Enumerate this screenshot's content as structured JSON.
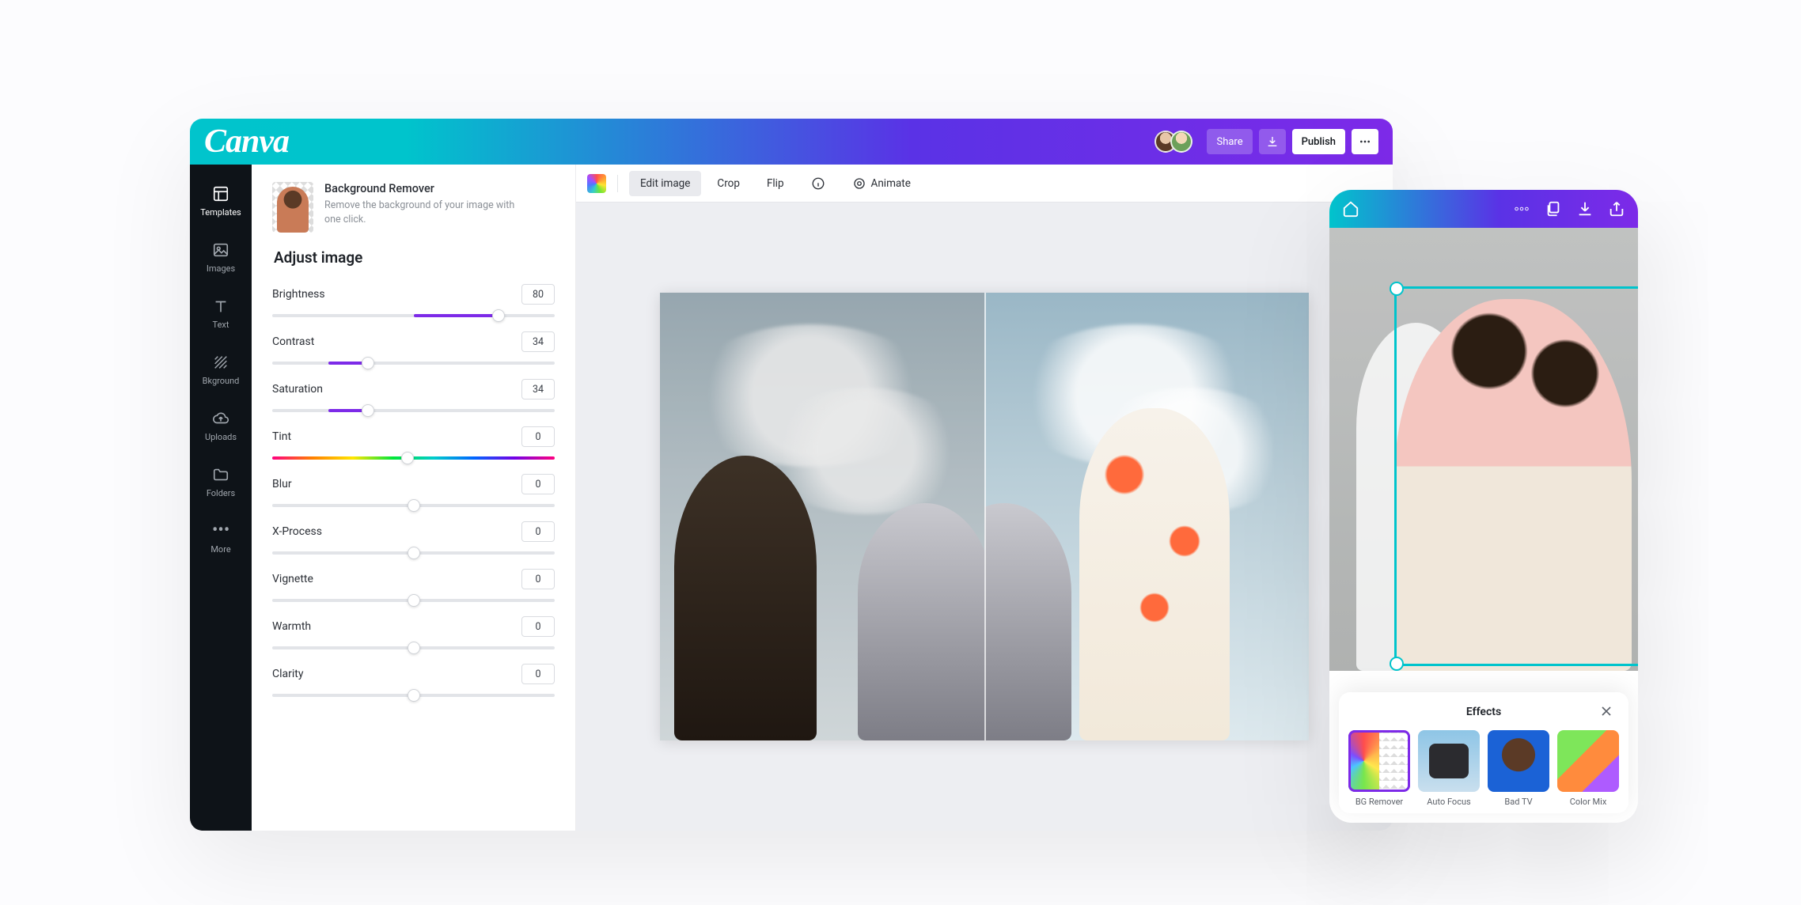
{
  "desktop": {
    "brand": "Canva",
    "header": {
      "share_label": "Share",
      "publish_label": "Publish"
    },
    "leftnav": [
      {
        "name": "templates",
        "label": "Templates",
        "icon": "templates-icon"
      },
      {
        "name": "images",
        "label": "Images",
        "icon": "image-icon"
      },
      {
        "name": "text",
        "label": "Text",
        "icon": "text-icon"
      },
      {
        "name": "bkground",
        "label": "Bkground",
        "icon": "background-icon"
      },
      {
        "name": "uploads",
        "label": "Uploads",
        "icon": "upload-icon"
      },
      {
        "name": "folders",
        "label": "Folders",
        "icon": "folder-icon"
      },
      {
        "name": "more",
        "label": "More",
        "icon": "more-icon"
      }
    ],
    "panel": {
      "bg_remover_title": "Background Remover",
      "bg_remover_sub": "Remove the background of your image with one click.",
      "heading": "Adjust image",
      "sliders": [
        {
          "key": "brightness",
          "label": "Brightness",
          "value": 80,
          "pct": 80,
          "variant": "normal",
          "fill_from": 50
        },
        {
          "key": "contrast",
          "label": "Contrast",
          "value": 34,
          "pct": 34,
          "variant": "normal",
          "fill_from": 20
        },
        {
          "key": "saturation",
          "label": "Saturation",
          "value": 34,
          "pct": 34,
          "variant": "normal",
          "fill_from": 20
        },
        {
          "key": "tint",
          "label": "Tint",
          "value": 0,
          "pct": 48,
          "variant": "tint"
        },
        {
          "key": "blur",
          "label": "Blur",
          "value": 0,
          "pct": 50,
          "variant": "plain"
        },
        {
          "key": "xprocess",
          "label": "X-Process",
          "value": 0,
          "pct": 50,
          "variant": "plain"
        },
        {
          "key": "vignette",
          "label": "Vignette",
          "value": 0,
          "pct": 50,
          "variant": "plain"
        },
        {
          "key": "warmth",
          "label": "Warmth",
          "value": 0,
          "pct": 50,
          "variant": "plain"
        },
        {
          "key": "clarity",
          "label": "Clarity",
          "value": 0,
          "pct": 50,
          "variant": "plain"
        }
      ]
    },
    "toolbar": {
      "edit_image": "Edit image",
      "crop": "Crop",
      "flip": "Flip",
      "animate": "Animate"
    }
  },
  "mobile": {
    "effects_title": "Effects",
    "effects": [
      {
        "key": "bgremover",
        "label": "BG Remover",
        "selected": true,
        "thumb": "th-bgremover"
      },
      {
        "key": "autofocus",
        "label": "Auto Focus",
        "selected": false,
        "thumb": "th-autofocus"
      },
      {
        "key": "badtv",
        "label": "Bad TV",
        "selected": false,
        "thumb": "th-badtv"
      },
      {
        "key": "colormix",
        "label": "Color Mix",
        "selected": false,
        "thumb": "th-colormix"
      }
    ]
  },
  "colors": {
    "accent_teal": "#00c4cc",
    "accent_purple": "#7d2ae8"
  }
}
